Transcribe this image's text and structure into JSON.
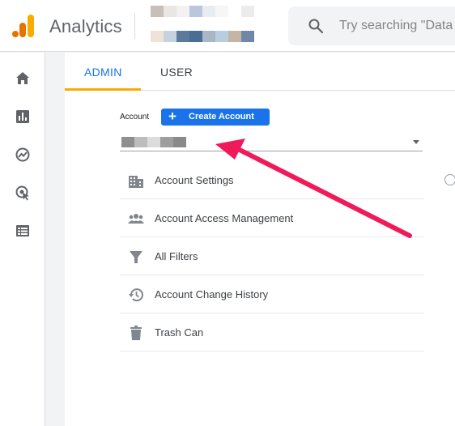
{
  "header": {
    "app_title": "Analytics",
    "search_placeholder": "Try searching \"Data"
  },
  "colors": {
    "accent": "#1a73e8",
    "tab_underline": "#f9ab00",
    "arrow": "#f0195a"
  },
  "sidebar": {
    "items": [
      {
        "icon": "home-icon"
      },
      {
        "icon": "reports-icon"
      },
      {
        "icon": "explore-icon"
      },
      {
        "icon": "advertising-icon"
      },
      {
        "icon": "configure-icon"
      }
    ]
  },
  "tabs": [
    {
      "label": "ADMIN",
      "active": true
    },
    {
      "label": "USER",
      "active": false
    }
  ],
  "account": {
    "label": "Account",
    "create_button": "Create Account"
  },
  "menu": [
    {
      "label": "Account Settings",
      "icon": "building-icon"
    },
    {
      "label": "Account Access Management",
      "icon": "people-icon"
    },
    {
      "label": "All Filters",
      "icon": "filter-icon"
    },
    {
      "label": "Account Change History",
      "icon": "history-icon"
    },
    {
      "label": "Trash Can",
      "icon": "trash-icon"
    }
  ]
}
